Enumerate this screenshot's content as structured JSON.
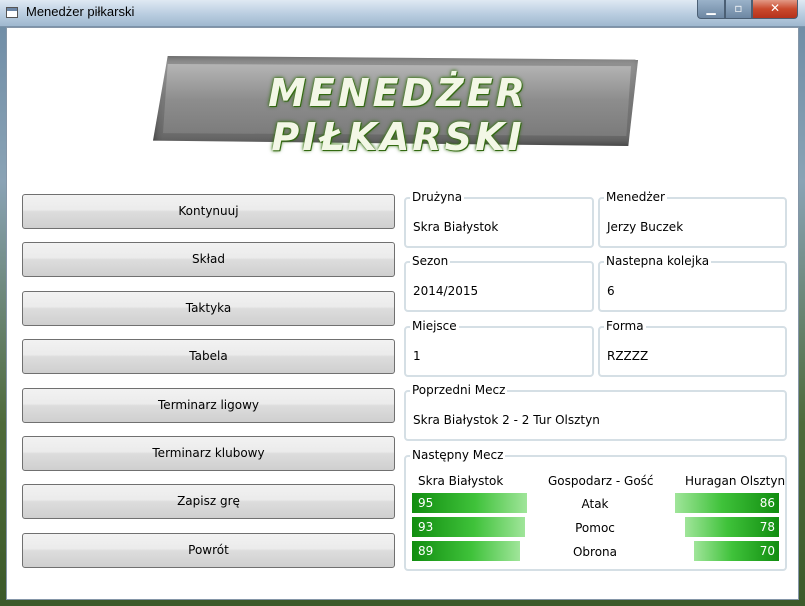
{
  "window": {
    "title": "Menedżer piłkarski"
  },
  "logo": {
    "text": "MENEDŻER PIŁKARSKI"
  },
  "menu": [
    {
      "label": "Kontynuuj"
    },
    {
      "label": "Skład"
    },
    {
      "label": "Taktyka"
    },
    {
      "label": "Tabela"
    },
    {
      "label": "Terminarz ligowy"
    },
    {
      "label": "Terminarz klubowy"
    },
    {
      "label": "Zapisz grę"
    },
    {
      "label": "Powrót"
    }
  ],
  "info": {
    "druzyna": {
      "label": "Drużyna",
      "value": "Skra Białystok"
    },
    "menedzer": {
      "label": "Menedżer",
      "value": "Jerzy Buczek"
    },
    "sezon": {
      "label": "Sezon",
      "value": "2014/2015"
    },
    "kolejka": {
      "label": "Nastepna kolejka",
      "value": "6"
    },
    "miejsce": {
      "label": "Miejsce",
      "value": "1"
    },
    "forma": {
      "label": "Forma",
      "value": "RZZZZ"
    },
    "poprzedni": {
      "label": "Poprzedni Mecz",
      "value": "Skra Białystok 2 - 2 Tur Olsztyn"
    }
  },
  "next_match": {
    "label": "Następny Mecz",
    "home": "Skra Białystok",
    "center": "Gospodarz - Gość",
    "away": "Huragan Olsztyn",
    "stats": [
      {
        "name": "Atak",
        "home": 95,
        "away": 86
      },
      {
        "name": "Pomoc",
        "home": 93,
        "away": 78
      },
      {
        "name": "Obrona",
        "home": 89,
        "away": 70
      }
    ]
  },
  "colors": {
    "bar_dark": "#118d10",
    "bar_light": "#a0e59a"
  }
}
